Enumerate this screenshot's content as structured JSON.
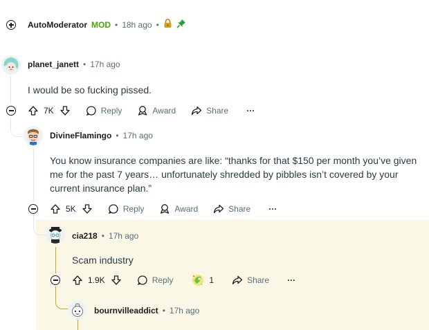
{
  "top_comment": {
    "username": "AutoModerator",
    "badge": "MOD",
    "time": "18h ago"
  },
  "comments": [
    {
      "username": "planet_janett",
      "time": "17h ago",
      "body": "I would be so fucking pissed.",
      "votes": "7K",
      "reply_label": "Reply",
      "award_label": "Award",
      "share_label": "Share",
      "more_label": "···"
    },
    {
      "username": "DivineFlamingo",
      "time": "17h ago",
      "body": "You know insurance companies are like: “thanks for that $150 per month you’ve given me for the past 7 years… unfortunately shredded by pibbles isn’t covered by your current insurance plan.”",
      "votes": "5K",
      "reply_label": "Reply",
      "award_label": "Award",
      "share_label": "Share",
      "more_label": "···"
    },
    {
      "username": "cia218",
      "time": "17h ago",
      "body": "Scam industry",
      "votes": "1.9K",
      "reply_label": "Reply",
      "award_count": "1",
      "share_label": "Share",
      "more_label": "···"
    },
    {
      "username": "bournvilleaddict",
      "time": "17h ago"
    }
  ],
  "colors": {
    "mod_green": "#46a508",
    "meta_gray": "#576f76",
    "thread_line": "#e3e6e8",
    "highlight_bg": "#fbf7e7",
    "highlight_line": "#c9a227"
  },
  "icons": {
    "expand": "plus-circle-icon",
    "collapse": "minus-circle-icon",
    "lock": "lock-icon",
    "pin": "pin-icon",
    "upvote": "upvote-arrow-icon",
    "downvote": "downvote-arrow-icon",
    "reply": "speech-bubble-icon",
    "award": "award-icon",
    "share": "share-arrow-icon"
  }
}
